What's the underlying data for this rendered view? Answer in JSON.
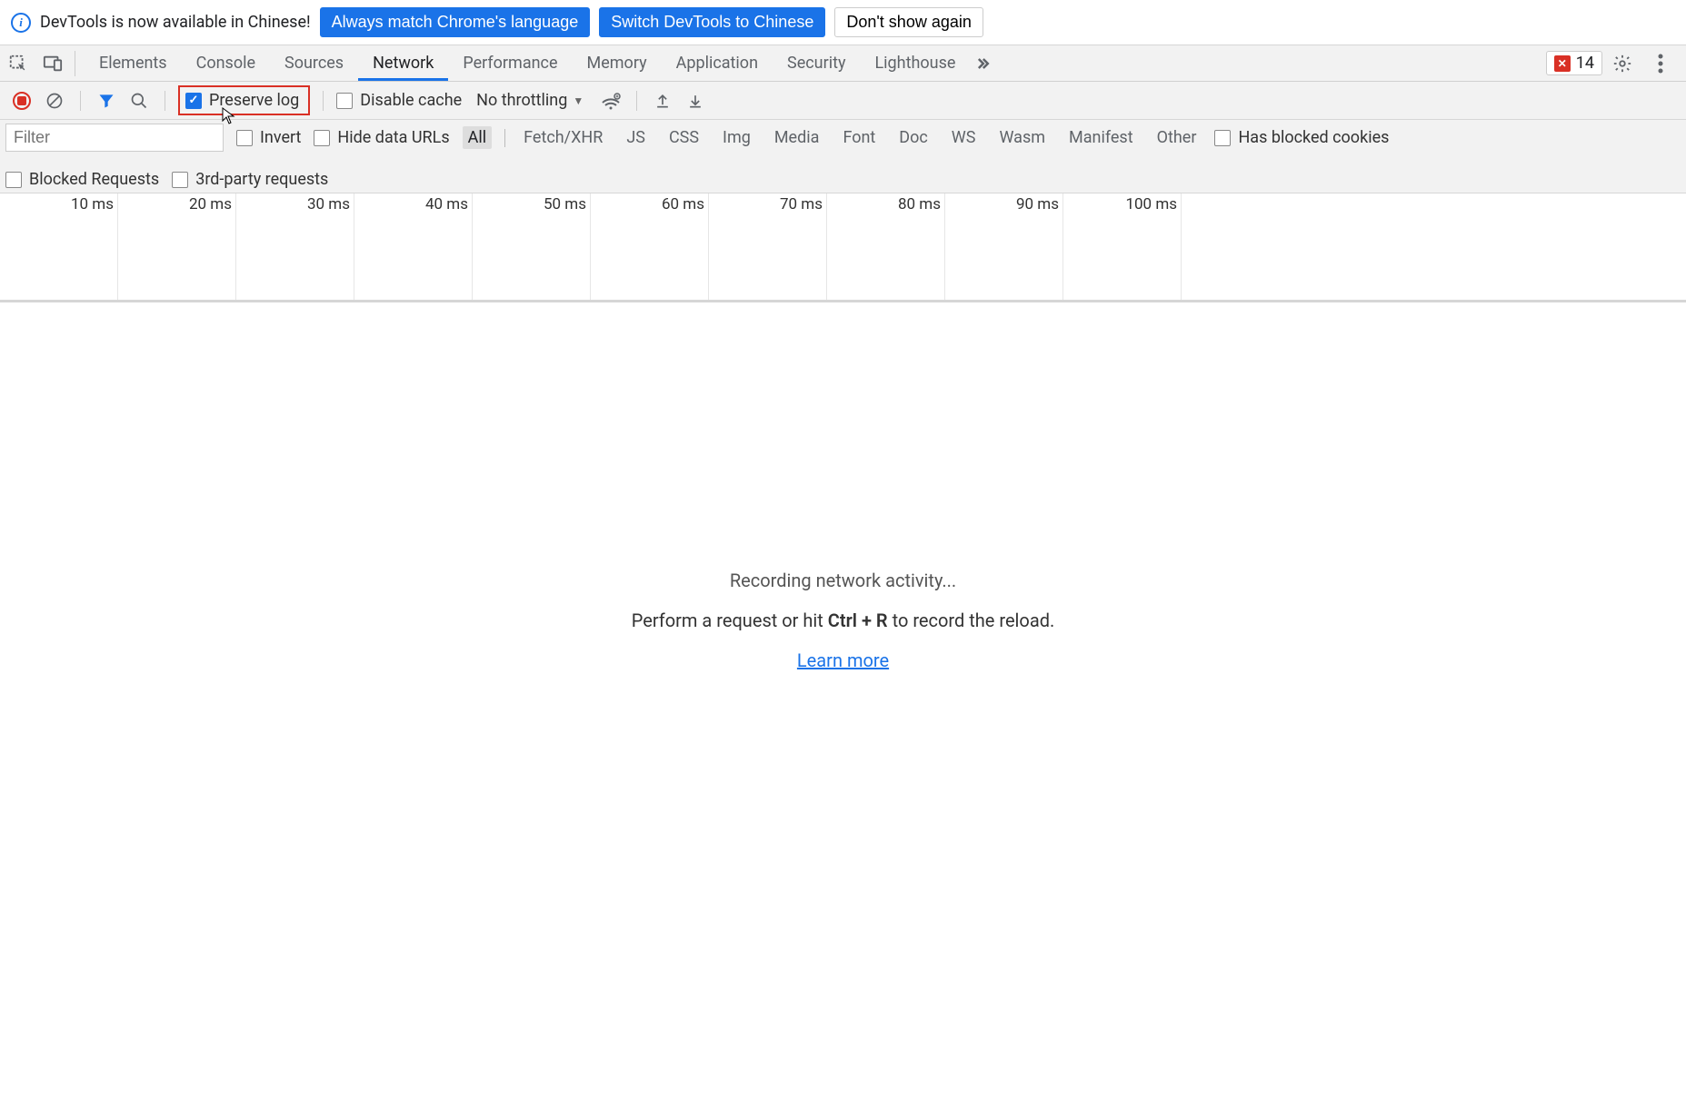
{
  "infobar": {
    "message": "DevTools is now available in Chinese!",
    "btn_always": "Always match Chrome's language",
    "btn_switch": "Switch DevTools to Chinese",
    "btn_dismiss": "Don't show again"
  },
  "tabs": {
    "items": [
      "Elements",
      "Console",
      "Sources",
      "Network",
      "Performance",
      "Memory",
      "Application",
      "Security",
      "Lighthouse"
    ],
    "active": "Network",
    "error_count": "14"
  },
  "toolbar": {
    "preserve_log": "Preserve log",
    "disable_cache": "Disable cache",
    "throttling": "No throttling"
  },
  "filters": {
    "filter_placeholder": "Filter",
    "invert": "Invert",
    "hide_data_urls": "Hide data URLs",
    "types": [
      "All",
      "Fetch/XHR",
      "JS",
      "CSS",
      "Img",
      "Media",
      "Font",
      "Doc",
      "WS",
      "Wasm",
      "Manifest",
      "Other"
    ],
    "active_type": "All",
    "has_blocked_cookies": "Has blocked cookies",
    "blocked_requests": "Blocked Requests",
    "third_party": "3rd-party requests"
  },
  "timeline": {
    "ticks": [
      "10 ms",
      "20 ms",
      "30 ms",
      "40 ms",
      "50 ms",
      "60 ms",
      "70 ms",
      "80 ms",
      "90 ms",
      "100 ms"
    ]
  },
  "empty": {
    "line1": "Recording network activity...",
    "line2_pre": "Perform a request or hit ",
    "line2_kbd": "Ctrl + R",
    "line2_post": " to record the reload.",
    "learn_more": "Learn more"
  }
}
